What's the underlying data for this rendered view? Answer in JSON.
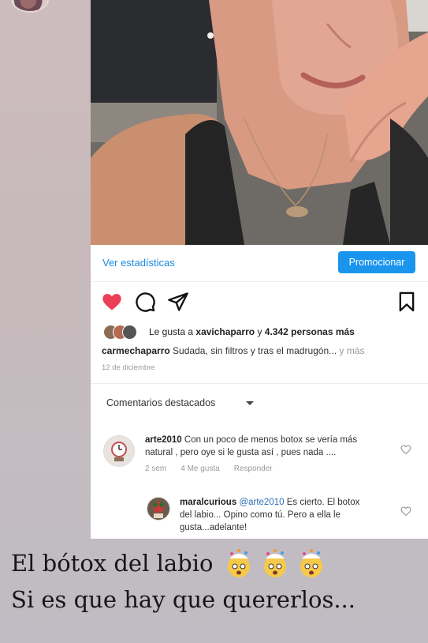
{
  "post": {
    "stats_link": "Ver estadísticas",
    "promote_button": "Promocionar",
    "likes": {
      "prefix": "Le gusta a ",
      "user": "xavichaparro",
      "connector": " y ",
      "count": "4.342 personas más"
    },
    "caption": {
      "user": "carmechaparro",
      "text": " Sudada, sin filtros y tras el madrugón...",
      "more": " y más"
    },
    "date": "12 de diciembre"
  },
  "comments_section": {
    "header": "Comentarios destacados",
    "comments": [
      {
        "user": "arte2010",
        "text_line1": " Con un poco de menos botox se vería más",
        "text_line2": "natural , pero oye si le gusta así , pues nada ....",
        "time": "2 sem",
        "likes": "4 Me gusta",
        "reply": "Responder"
      },
      {
        "user": "maralcurious",
        "mention": "@arte2010",
        "text_line1": " Es cierto. El botox",
        "text_line2": "del labio... Opino como tú. Pero a ella le",
        "text_line3": "gusta...adelante!"
      }
    ]
  },
  "overlay": {
    "line1": "El bótox del labio",
    "line2": "Si es que hay que quererlos..."
  },
  "colors": {
    "like_red": "#ed3e57",
    "promote_blue": "#1a95ee",
    "link_blue": "#1a8be0"
  }
}
